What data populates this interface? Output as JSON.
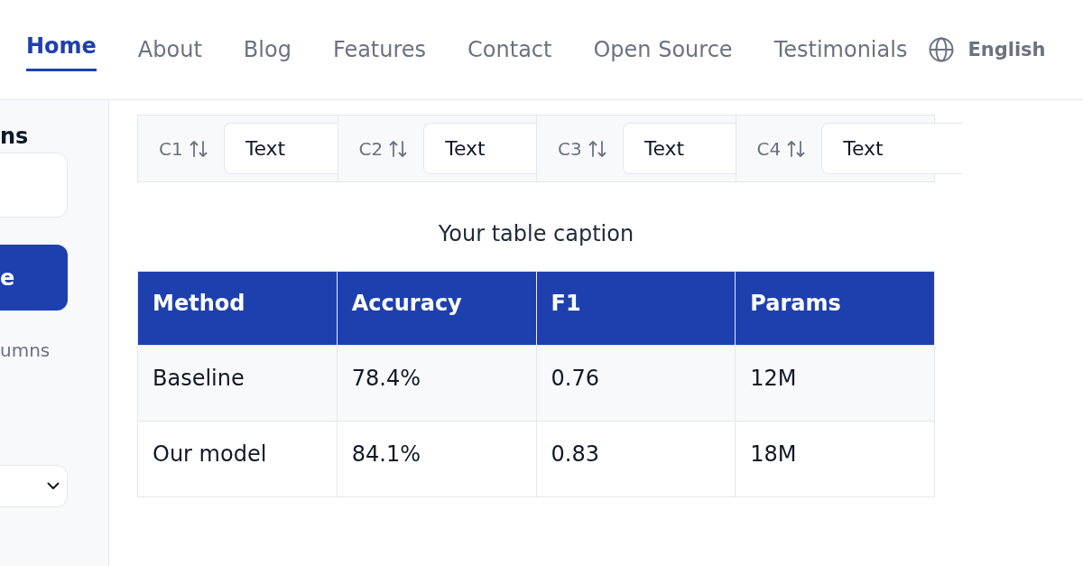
{
  "nav": {
    "links": [
      {
        "label": "Home",
        "selected": true
      },
      {
        "label": "About",
        "selected": false
      },
      {
        "label": "Blog",
        "selected": false
      },
      {
        "label": "Features",
        "selected": false
      },
      {
        "label": "Contact",
        "selected": false
      },
      {
        "label": "Open Source",
        "selected": false
      },
      {
        "label": "Testimonials",
        "selected": false
      }
    ],
    "language": {
      "label": "English"
    }
  },
  "sidebar": {
    "label": "ns",
    "button": "e",
    "hint": "umns"
  },
  "filters": [
    {
      "label": "C1",
      "value": "Text"
    },
    {
      "label": "C2",
      "value": "Text"
    },
    {
      "label": "C3",
      "value": "Text"
    },
    {
      "label": "C4",
      "value": "Text"
    }
  ],
  "table": {
    "caption": "Your table caption",
    "columns": [
      "Method",
      "Accuracy",
      "F1",
      "Params"
    ],
    "rows": [
      [
        "Baseline",
        "78.4%",
        "0.76",
        "12M"
      ],
      [
        "Our model",
        "84.1%",
        "0.83",
        "18M"
      ]
    ]
  }
}
